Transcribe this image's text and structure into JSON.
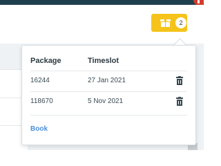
{
  "header": {
    "basket_count": "2",
    "basket_icon": "package-icon"
  },
  "popover": {
    "columns": {
      "package": "Package",
      "timeslot": "Timeslot"
    },
    "rows": [
      {
        "package": "16244",
        "timeslot": "27 Jan 2021",
        "action_icon": "trash-icon"
      },
      {
        "package": "118670",
        "timeslot": "5 Nov 2021",
        "action_icon": "trash-icon"
      }
    ],
    "book_label": "Book"
  },
  "colors": {
    "topbar": "#1f3f4c",
    "accent_yellow": "#f6c31b",
    "link_blue": "#4a90d9",
    "alert_red": "#d63a2b"
  }
}
